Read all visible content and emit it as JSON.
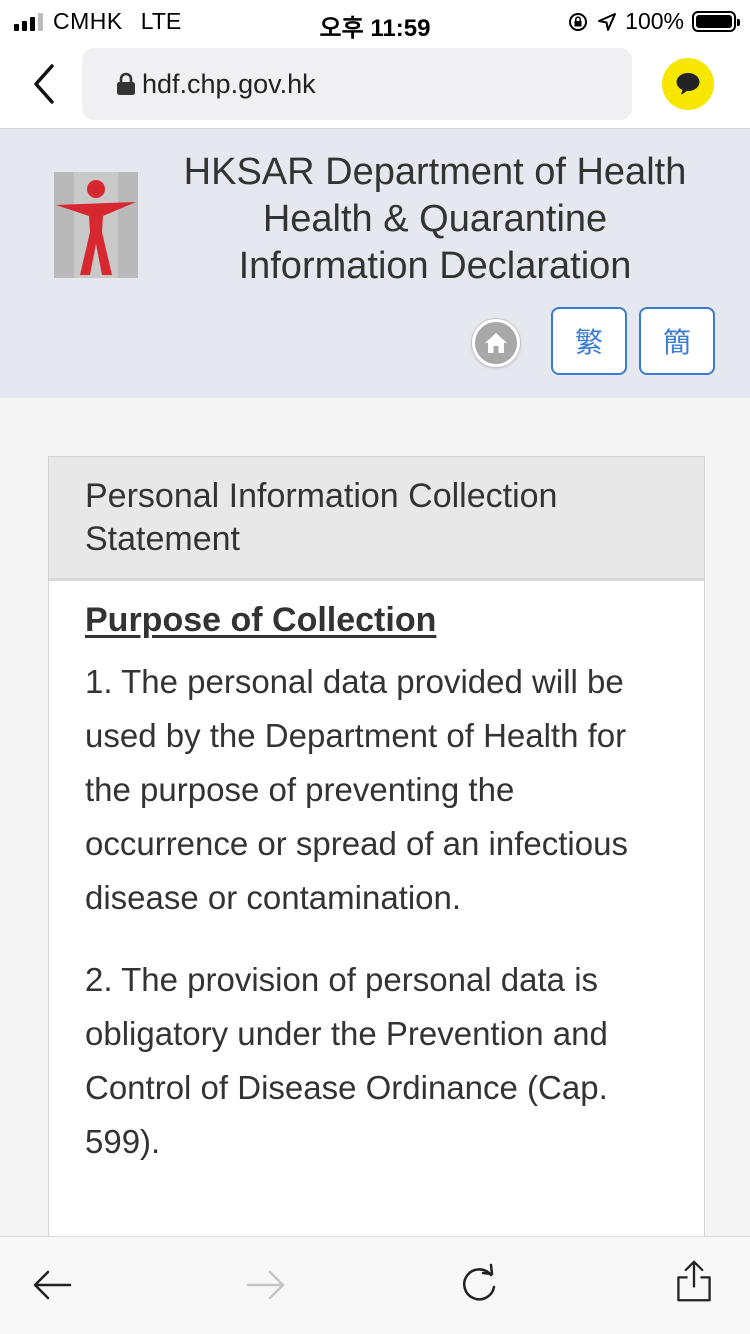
{
  "status_bar": {
    "carrier": "CMHK",
    "network": "LTE",
    "time": "오후 11:59",
    "battery": "100%"
  },
  "browser": {
    "url": "hdf.chp.gov.hk"
  },
  "header": {
    "title_line1": "HKSAR Department of Health",
    "title_line2": "Health & Quarantine",
    "title_line3": "Information Declaration",
    "lang_traditional": "繁",
    "lang_simplified": "簡"
  },
  "panel": {
    "heading_line1": "Personal Information Collection",
    "heading_line2": "Statement",
    "section_title": "Purpose of Collection",
    "paragraphs": [
      "1. The personal data provided will be used by the Department of Health for the purpose of preventing the occurrence or spread of an infectious disease or contamination.",
      "2. The provision of personal data is obligatory under the Prevention and Control of Disease Ordinance (Cap. 599)."
    ]
  },
  "colors": {
    "accent_blue": "#3a7bd5",
    "header_bg": "#e5e8ee",
    "chat_yellow": "#f7e600",
    "logo_red": "#d7282f"
  },
  "icons": {
    "back": "chevron-left-icon",
    "lock": "lock-icon",
    "chat": "chat-bubble-icon",
    "home": "home-icon",
    "nav_back": "arrow-left-icon",
    "nav_forward": "arrow-right-icon",
    "reload": "reload-icon",
    "share": "share-icon"
  }
}
